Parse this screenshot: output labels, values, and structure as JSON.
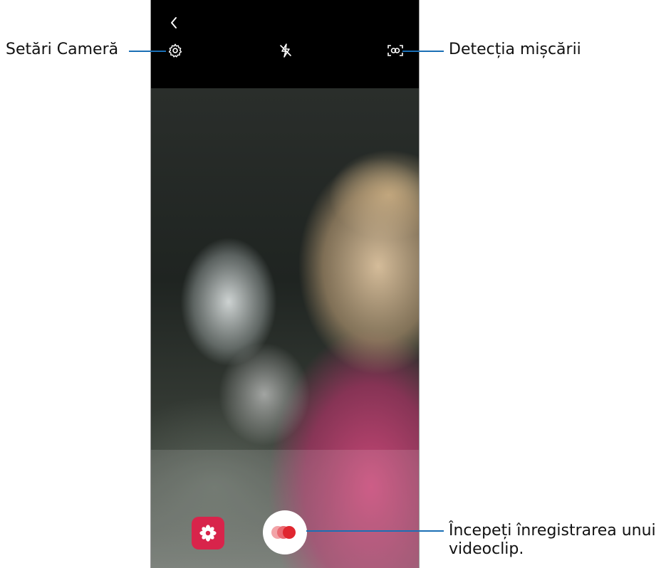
{
  "callouts": {
    "settings_label": "Setări Cameră",
    "motion_label": "Detecția mișcării",
    "record_label": "Începeți înregistrarea unui videoclip."
  },
  "icons": {
    "back": "chevron-left-icon",
    "settings": "gear-icon",
    "flash": "flash-off-icon",
    "motion": "motion-detection-icon",
    "effects": "flower-icon",
    "record": "record-icon"
  },
  "colors": {
    "callout_line": "#1a6fb5",
    "effects_button": "#d8244b",
    "record_dot": "#e0262f"
  }
}
